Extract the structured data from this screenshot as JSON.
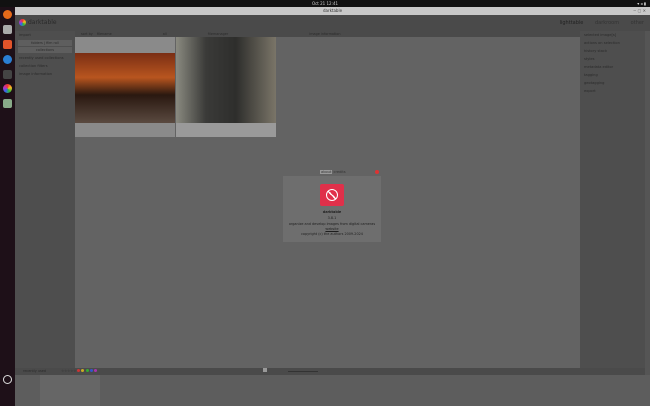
{
  "system": {
    "clock": "Oct 21  12:41"
  },
  "window": {
    "title": "darktable"
  },
  "app": {
    "name": "darktable",
    "views": [
      "lighttable",
      "darkroom",
      "other"
    ],
    "active_view": "lighttable"
  },
  "left_panel": {
    "items": [
      "import",
      "folders | film roll",
      "collections",
      "recently used collections",
      "collection filters",
      "image information"
    ]
  },
  "toolbar": {
    "sort_label": "sort by",
    "sort_value": "filename",
    "rating_label": "all",
    "grouping": "G",
    "culling": "filemanager",
    "info": "image information"
  },
  "right_panel": {
    "items": [
      "selected image[s]",
      "actions on selection",
      "history stack",
      "styles",
      "metadata editor",
      "tagging",
      "geotagging",
      "export"
    ]
  },
  "bottom": {
    "module": "recently used",
    "ratings": "☆☆☆☆☆",
    "color_labels": [
      "#cc3333",
      "#ccaa22",
      "#33aa33",
      "#3355cc",
      "#aa33aa"
    ]
  },
  "dialog": {
    "tabs": [
      "about",
      "credits"
    ],
    "name": "darktable",
    "version": "3.8.1",
    "description": "organize and develop images from digital cameras",
    "website": "website",
    "copyright": "copyright (c) the authors 2009-2024"
  }
}
